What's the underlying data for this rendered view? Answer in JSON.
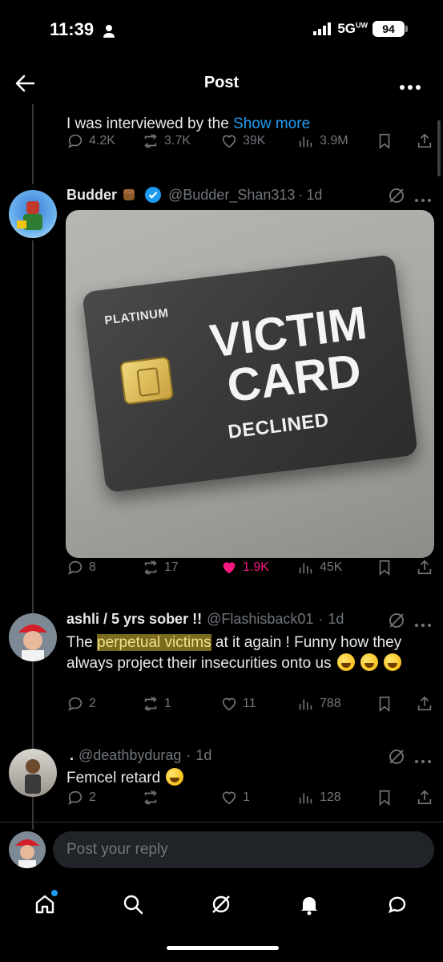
{
  "status_bar": {
    "time": "11:39",
    "network": "5G",
    "network_sup": "UW",
    "battery": "94"
  },
  "header": {
    "title": "Post"
  },
  "post_prev": {
    "text_prefix": "I was interviewed by the",
    "show_more": "Show more",
    "replies": "4.2K",
    "reposts": "3.7K",
    "likes": "39K",
    "views": "3.9M"
  },
  "post_main": {
    "name": "Budder",
    "handle": "@Budder_Shan313",
    "time": "1d",
    "image": {
      "label_top": "PLATINUM",
      "label_main_1": "VICTIM",
      "label_main_2": "CARD",
      "label_bottom": "DECLINED"
    },
    "replies": "8",
    "reposts": "17",
    "likes": "1.9K",
    "views": "45K"
  },
  "reply1": {
    "name": "ashli / 5 yrs sober !!",
    "handle": "@Flashisback01",
    "time": "1d",
    "text_pre": "The ",
    "text_highlight": "perpetual victims",
    "text_post": " at it again ! Funny how they always project their insecurities onto us",
    "replies": "2",
    "reposts": "1",
    "likes": "11",
    "views": "788"
  },
  "reply2": {
    "name": ".",
    "handle": "@deathbydurag",
    "time": "1d",
    "text": "Femcel retard",
    "replies": "2",
    "reposts": "",
    "likes": "1",
    "views": "128"
  },
  "reply_box": {
    "placeholder": "Post your reply"
  },
  "colors": {
    "accent": "#1d9bf0",
    "like": "#f91880",
    "muted": "#71767b",
    "background": "#000000"
  }
}
